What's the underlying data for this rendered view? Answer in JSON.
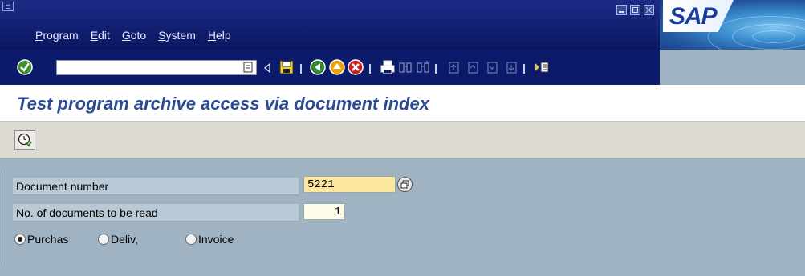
{
  "menubar": {
    "items": [
      {
        "label_u": "P",
        "label_rest": "rogram"
      },
      {
        "label_u": "E",
        "label_rest": "dit"
      },
      {
        "label_u": "G",
        "label_rest": "oto"
      },
      {
        "label_u": "S",
        "label_rest": "ystem"
      },
      {
        "label_u": "H",
        "label_rest": "elp"
      }
    ],
    "logo_text": "SAP"
  },
  "toolbar": {
    "command_field_value": ""
  },
  "screen": {
    "title": "Test program archive access via document index"
  },
  "form": {
    "doc_number_label": "Document number",
    "doc_number_value": "5221",
    "count_label": "No. of documents to be read",
    "count_value": "1",
    "radios": [
      {
        "label": "Purchas",
        "selected": true
      },
      {
        "label": "Deliv,",
        "selected": false
      },
      {
        "label": "Invoice",
        "selected": false
      }
    ]
  },
  "colors": {
    "menubar_bg": "#1c2c86",
    "title_text": "#2a4a95",
    "form_bg": "#9fb3c3",
    "required_field": "#fbe79d"
  }
}
